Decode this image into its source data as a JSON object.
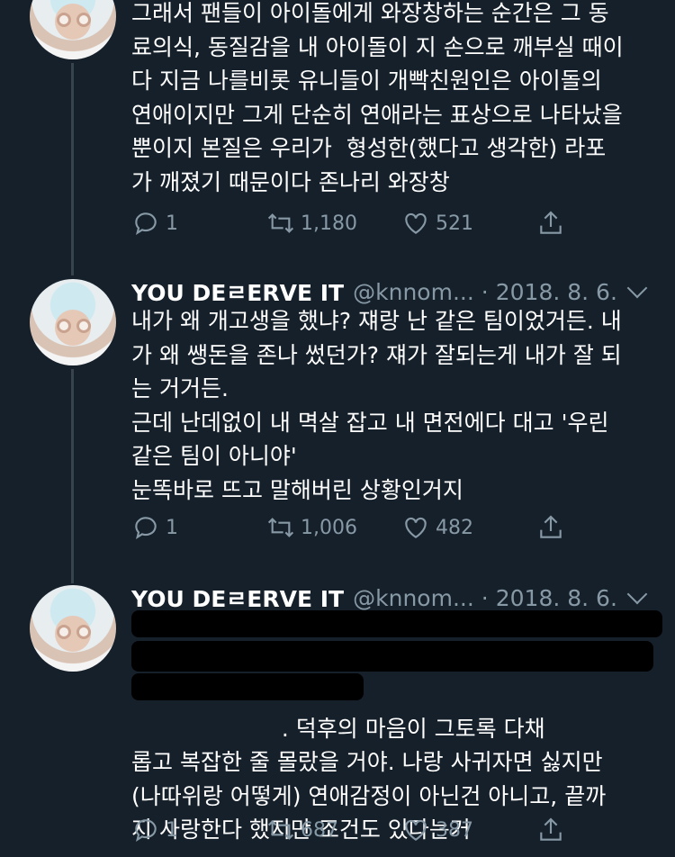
{
  "tweets": [
    {
      "name": "",
      "handle": "",
      "date": "",
      "text": "그래서 팬들이 아이돌에게 와장창하는 순간은 그 동\n료의식, 동질감을 내 아이돌이 지 손으로 깨부실 때이\n다 지금 나를비롯 유니들이 개빡친원인은 아이돌의\n연애이지만 그게 단순히 연애라는 표상으로 나타났을\n뿐이지 본질은 우리가  형성한(했다고 생각한) 라포\n가 깨졌기 때문이다 존나리 와장창",
      "replies": "1",
      "retweets": "1,180",
      "likes": "521"
    },
    {
      "name": "YOU DEㄹERVE IT",
      "handle": "@knnom...",
      "date": "2018. 8. 6.",
      "text": "내가 왜 개고생을 했냐? 쟤랑 난 같은 팀이었거든. 내\n가 왜 쌩돈을 존나 썼던가? 쟤가 잘되는게 내가 잘 되\n는 거거든.\n근데 난데없이 내 멱살 잡고 내 면전에다 대고 '우린\n같은 팀이 아니야'\n눈똑바로 뜨고 말해버린 상황인거지",
      "replies": "1",
      "retweets": "1,006",
      "likes": "482"
    },
    {
      "name": "YOU DEㄹERVE IT",
      "handle": "@knnom...",
      "date": "2018. 8. 6.",
      "text": "\n\n\n                     . 덕후의 마음이 그토록 다채\n롭고 복잡한 줄 몰랐을 거야. 나랑 사귀자면 싫지만\n(나따위랑 어떻게) 연애감정이 아닌건 아니고, 끝까\n지 사랑한다 했지만 조건도 있다는거",
      "replies": "1",
      "retweets": "687",
      "likes": "387"
    }
  ],
  "icons": {
    "reply": "reply-icon",
    "retweet": "retweet-icon",
    "like": "heart-icon",
    "share": "share-icon",
    "more": "chevron-down-icon"
  },
  "colors": {
    "background": "#15202b",
    "secondary_text": "#8899a6",
    "thread_line": "#38444d"
  }
}
